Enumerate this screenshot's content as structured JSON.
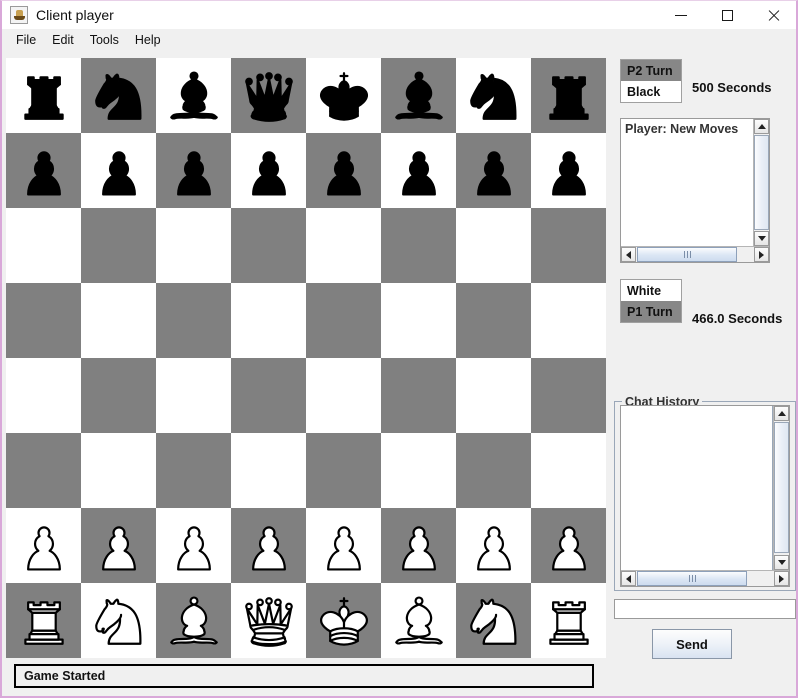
{
  "window": {
    "title": "Client player",
    "icon": "java-coffee-cup-icon",
    "minimize_label": "—",
    "maximize_label": "□",
    "close_label": "✕"
  },
  "menubar": {
    "items": [
      {
        "label": "File"
      },
      {
        "label": "Edit"
      },
      {
        "label": "Tools"
      },
      {
        "label": "Help"
      }
    ]
  },
  "board": {
    "light_color": "#ffffff",
    "dark_color": "#808080",
    "rows": [
      [
        "br",
        "bn",
        "bb",
        "bq",
        "bk",
        "bb",
        "bn",
        "br"
      ],
      [
        "bp",
        "bp",
        "bp",
        "bp",
        "bp",
        "bp",
        "bp",
        "bp"
      ],
      [
        "",
        "",
        "",
        "",
        "",
        "",
        "",
        ""
      ],
      [
        "",
        "",
        "",
        "",
        "",
        "",
        "",
        ""
      ],
      [
        "",
        "",
        "",
        "",
        "",
        "",
        "",
        ""
      ],
      [
        "",
        "",
        "",
        "",
        "",
        "",
        "",
        ""
      ],
      [
        "wp",
        "wp",
        "wp",
        "wp",
        "wp",
        "wp",
        "wp",
        "wp"
      ],
      [
        "wr",
        "wn",
        "wb",
        "wq",
        "wk",
        "wb",
        "wn",
        "wr"
      ]
    ]
  },
  "players": {
    "p2": {
      "turn_label": "P2  Turn",
      "color_label": "Black",
      "turn_active": true,
      "timer": "500 Seconds"
    },
    "p1": {
      "color_label": "White",
      "turn_label": "P1  Turn",
      "turn_active": true,
      "timer": "466.0 Seconds"
    }
  },
  "moves_panel": {
    "text": "Player: New Moves"
  },
  "chat": {
    "title": "Chat History",
    "body": "",
    "input_value": "",
    "input_placeholder": "",
    "send_label": "Send"
  },
  "status": {
    "message": "Game Started"
  }
}
